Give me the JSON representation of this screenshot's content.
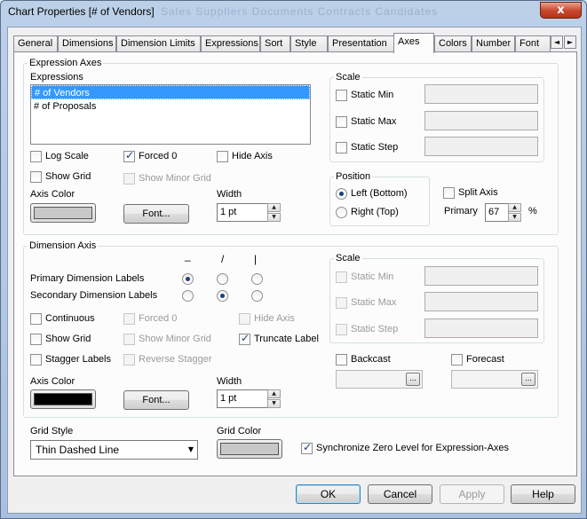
{
  "window": {
    "title": "Chart Properties [# of Vendors]",
    "ghost_title": "Sales   Suppliers   Documents   Contracts   Candidates",
    "close_glyph": "x"
  },
  "tabs": [
    "General",
    "Dimensions",
    "Dimension Limits",
    "Expressions",
    "Sort",
    "Style",
    "Presentation",
    "Axes",
    "Colors",
    "Number",
    "Font"
  ],
  "active_tab": "Axes",
  "tab_scroll": {
    "left": "◄",
    "right": "►"
  },
  "expression_axes": {
    "group_label": "Expression Axes",
    "expressions_label": "Expressions",
    "expressions": [
      {
        "label": "# of Vendors",
        "selected": true
      },
      {
        "label": "# of Proposals",
        "selected": false
      }
    ],
    "log_scale": {
      "label": "Log Scale",
      "checked": false
    },
    "forced_0": {
      "label": "Forced 0",
      "checked": true
    },
    "hide_axis": {
      "label": "Hide Axis",
      "checked": false
    },
    "show_grid": {
      "label": "Show Grid",
      "checked": false
    },
    "show_minor_grid": {
      "label": "Show Minor Grid",
      "checked": false,
      "disabled": true
    },
    "axis_color_label": "Axis Color",
    "axis_color": "#c8c8c8",
    "font_button": "Font...",
    "width_label": "Width",
    "width_value": "1 pt",
    "scale": {
      "group_label": "Scale",
      "static_min": "Static Min",
      "static_max": "Static Max",
      "static_step": "Static Step"
    },
    "position": {
      "group_label": "Position",
      "left_bottom": "Left (Bottom)",
      "right_top": "Right (Top)",
      "selected": "left_bottom"
    },
    "split_axis": {
      "label": "Split Axis",
      "checked": false
    },
    "primary_label": "Primary",
    "primary_value": "67",
    "percent": "%"
  },
  "dimension_axis": {
    "group_label": "Dimension Axis",
    "orientation_headers": [
      "_",
      "/",
      "|"
    ],
    "primary_labels": "Primary Dimension Labels",
    "primary_selected": 0,
    "secondary_labels": "Secondary Dimension Labels",
    "secondary_selected": 1,
    "continuous": {
      "label": "Continuous",
      "checked": false
    },
    "forced_0": {
      "label": "Forced 0",
      "disabled": true
    },
    "hide_axis": {
      "label": "Hide Axis",
      "disabled": true
    },
    "show_grid": {
      "label": "Show Grid",
      "checked": false
    },
    "show_minor_grid": {
      "label": "Show Minor Grid",
      "disabled": true
    },
    "truncate_label": {
      "label": "Truncate Label",
      "checked": true
    },
    "stagger_labels": {
      "label": "Stagger Labels",
      "checked": false
    },
    "reverse_stagger": {
      "label": "Reverse Stagger",
      "disabled": true
    },
    "axis_color_label": "Axis Color",
    "axis_color": "#000000",
    "font_button": "Font...",
    "width_label": "Width",
    "width_value": "1 pt",
    "scale": {
      "group_label": "Scale",
      "static_min": "Static Min",
      "static_max": "Static Max",
      "static_step": "Static Step"
    },
    "backcast": {
      "label": "Backcast",
      "checked": false
    },
    "forecast": {
      "label": "Forecast",
      "checked": false
    },
    "browse_glyph": "..."
  },
  "grid_style": {
    "label": "Grid Style",
    "value": "Thin Dashed Line"
  },
  "grid_color": {
    "label": "Grid Color",
    "color": "#c8c8c8"
  },
  "sync_zero": {
    "label": "Synchronize Zero Level for Expression-Axes",
    "checked": true
  },
  "buttons": {
    "ok": "OK",
    "cancel": "Cancel",
    "apply": "Apply",
    "help": "Help"
  },
  "glyphs": {
    "check": "✓",
    "up": "▲",
    "down": "▼",
    "combo": "▼"
  }
}
